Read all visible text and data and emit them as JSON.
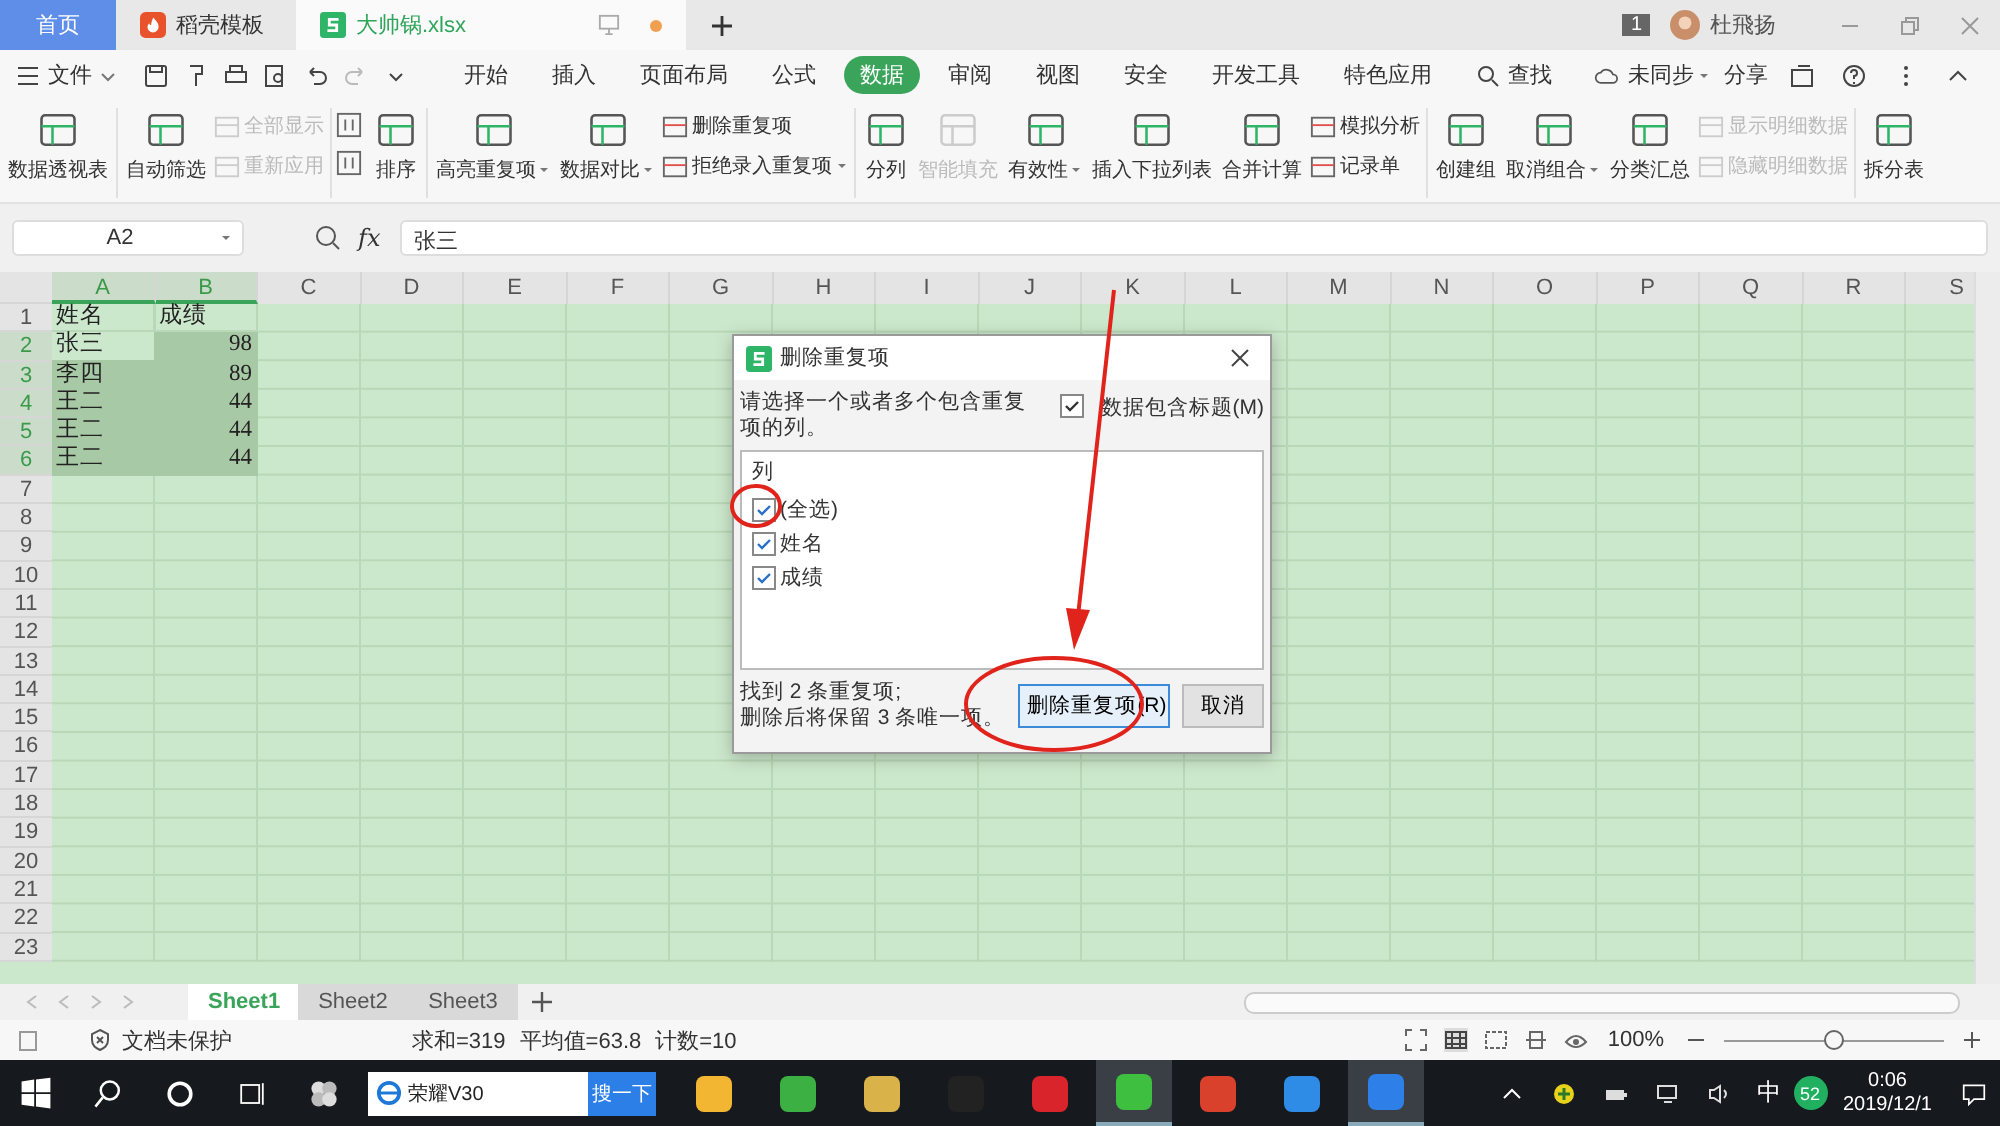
{
  "doc_tabs": [
    {
      "kind": "home",
      "label": "首页",
      "selected": false
    },
    {
      "kind": "template",
      "label": "稻壳模板",
      "selected": false
    },
    {
      "kind": "sheet",
      "label": "大帅锅.xlsx",
      "selected": true
    }
  ],
  "account": {
    "badge": "1",
    "name": "杜飛扬"
  },
  "menu": {
    "file": "文件",
    "tabs": [
      {
        "label": "开始",
        "selected": false
      },
      {
        "label": "插入",
        "selected": false
      },
      {
        "label": "页面布局",
        "selected": false
      },
      {
        "label": "公式",
        "selected": false
      },
      {
        "label": "数据",
        "selected": true
      },
      {
        "label": "审阅",
        "selected": false
      },
      {
        "label": "视图",
        "selected": false
      },
      {
        "label": "安全",
        "selected": false
      },
      {
        "label": "开发工具",
        "selected": false
      },
      {
        "label": "特色应用",
        "selected": false
      }
    ],
    "search": "查找",
    "sync": "未同步",
    "share": "分享"
  },
  "ribbon": [
    [
      {
        "kind": "large",
        "label": "数据透视表",
        "disabled": false,
        "dropdown": false
      }
    ],
    [
      {
        "kind": "large",
        "label": "自动筛选",
        "disabled": false,
        "dropdown": false
      },
      {
        "kind": "stack",
        "rows": [
          {
            "label": "全部显示",
            "disabled": true,
            "dropdown": false
          },
          {
            "label": "重新应用",
            "disabled": true,
            "dropdown": false
          }
        ]
      }
    ],
    [
      {
        "kind": "sort",
        "label": "排序",
        "disabled": false,
        "dropdown": false
      }
    ],
    [
      {
        "kind": "large",
        "label": "高亮重复项",
        "disabled": false,
        "dropdown": true
      },
      {
        "kind": "large",
        "label": "数据对比",
        "disabled": false,
        "dropdown": true
      },
      {
        "kind": "stack",
        "rows": [
          {
            "label": "删除重复项",
            "disabled": false,
            "dropdown": false
          },
          {
            "label": "拒绝录入重复项",
            "disabled": false,
            "dropdown": true
          }
        ]
      }
    ],
    [
      {
        "kind": "large",
        "label": "分列",
        "disabled": false,
        "dropdown": false
      },
      {
        "kind": "large",
        "label": "智能填充",
        "disabled": true,
        "dropdown": false
      },
      {
        "kind": "large",
        "label": "有效性",
        "disabled": false,
        "dropdown": true
      },
      {
        "kind": "large",
        "label": "插入下拉列表",
        "disabled": false,
        "dropdown": false
      },
      {
        "kind": "large",
        "label": "合并计算",
        "disabled": false,
        "dropdown": false
      },
      {
        "kind": "stack",
        "rows": [
          {
            "label": "模拟分析",
            "disabled": false,
            "dropdown": false
          },
          {
            "label": "记录单",
            "disabled": false,
            "dropdown": false
          }
        ]
      }
    ],
    [
      {
        "kind": "large",
        "label": "创建组",
        "disabled": false,
        "dropdown": false
      },
      {
        "kind": "large",
        "label": "取消组合",
        "disabled": false,
        "dropdown": true
      },
      {
        "kind": "large",
        "label": "分类汇总",
        "disabled": false,
        "dropdown": false
      },
      {
        "kind": "stack",
        "rows": [
          {
            "label": "显示明细数据",
            "disabled": true,
            "dropdown": false
          },
          {
            "label": "隐藏明细数据",
            "disabled": true,
            "dropdown": false
          }
        ]
      }
    ],
    [
      {
        "kind": "large",
        "label": "拆分表",
        "disabled": false,
        "dropdown": false
      }
    ]
  ],
  "formula_bar": {
    "cell": "A2",
    "fx": "fx",
    "value": "张三"
  },
  "columns": [
    {
      "label": "A",
      "selected": true
    },
    {
      "label": "B",
      "selected": true
    },
    {
      "label": "C",
      "selected": false
    },
    {
      "label": "D",
      "selected": false
    },
    {
      "label": "E",
      "selected": false
    },
    {
      "label": "F",
      "selected": false
    },
    {
      "label": "G",
      "selected": false
    },
    {
      "label": "H",
      "selected": false
    },
    {
      "label": "I",
      "selected": false
    },
    {
      "label": "J",
      "selected": false
    },
    {
      "label": "K",
      "selected": false
    },
    {
      "label": "L",
      "selected": false
    },
    {
      "label": "M",
      "selected": false
    },
    {
      "label": "N",
      "selected": false
    },
    {
      "label": "O",
      "selected": false
    },
    {
      "label": "P",
      "selected": false
    },
    {
      "label": "Q",
      "selected": false
    },
    {
      "label": "R",
      "selected": false
    },
    {
      "label": "S",
      "selected": false
    }
  ],
  "rows": [
    {
      "number": "1",
      "selected": false,
      "cells": [
        {
          "text": "姓名",
          "numeric": false,
          "active": false
        },
        {
          "text": "成绩",
          "numeric": false,
          "active": false
        }
      ]
    },
    {
      "number": "2",
      "selected": true,
      "cells": [
        {
          "text": "张三",
          "numeric": false,
          "active": true
        },
        {
          "text": "98",
          "numeric": true,
          "active": false
        }
      ]
    },
    {
      "number": "3",
      "selected": true,
      "cells": [
        {
          "text": "李四",
          "numeric": false,
          "active": false
        },
        {
          "text": "89",
          "numeric": true,
          "active": false
        }
      ]
    },
    {
      "number": "4",
      "selected": true,
      "cells": [
        {
          "text": "王二",
          "numeric": false,
          "active": false
        },
        {
          "text": "44",
          "numeric": true,
          "active": false
        }
      ]
    },
    {
      "number": "5",
      "selected": true,
      "cells": [
        {
          "text": "王二",
          "numeric": false,
          "active": false
        },
        {
          "text": "44",
          "numeric": true,
          "active": false
        }
      ]
    },
    {
      "number": "6",
      "selected": true,
      "cells": [
        {
          "text": "王二",
          "numeric": false,
          "active": false
        },
        {
          "text": "44",
          "numeric": true,
          "active": false
        }
      ]
    },
    {
      "number": "7",
      "selected": false
    },
    {
      "number": "8",
      "selected": false
    },
    {
      "number": "9",
      "selected": false
    },
    {
      "number": "10",
      "selected": false
    },
    {
      "number": "11",
      "selected": false
    },
    {
      "number": "12",
      "selected": false
    },
    {
      "number": "13",
      "selected": false
    },
    {
      "number": "14",
      "selected": false
    },
    {
      "number": "15",
      "selected": false
    },
    {
      "number": "16",
      "selected": false
    },
    {
      "number": "17",
      "selected": false
    },
    {
      "number": "18",
      "selected": false
    },
    {
      "number": "19",
      "selected": false
    },
    {
      "number": "20",
      "selected": false
    },
    {
      "number": "21",
      "selected": false
    },
    {
      "number": "22",
      "selected": false
    },
    {
      "number": "23",
      "selected": false
    }
  ],
  "dialog": {
    "title": "删除重复项",
    "prompt": "请选择一个或者多个包含重复项的列。",
    "header_option": {
      "label": "数据包含标题(M)",
      "checked": true
    },
    "list_header": "列",
    "columns": [
      {
        "label": "(全选)",
        "checked": true
      },
      {
        "label": "姓名",
        "checked": true
      },
      {
        "label": "成绩",
        "checked": true
      }
    ],
    "summary": [
      "找到 2 条重复项;",
      "删除后将保留 3 条唯一项。"
    ],
    "confirm": "删除重复项(R)",
    "cancel": "取消"
  },
  "sheets": [
    {
      "label": "Sheet1",
      "selected": true
    },
    {
      "label": "Sheet2",
      "selected": false
    },
    {
      "label": "Sheet3",
      "selected": false
    }
  ],
  "status": {
    "protection": "文档未保护",
    "stats": [
      "求和=319",
      "平均值=63.8",
      "计数=10"
    ],
    "zoom": "100%",
    "zoom_level": {
      "level": 0.5
    }
  },
  "taskbar": {
    "search": "荣耀V30",
    "search_button": "搜一下",
    "apps": [
      {
        "color": "#f2b632",
        "selected": false
      },
      {
        "color": "#3cb043",
        "selected": false
      },
      {
        "color": "#d9b24a",
        "selected": false
      },
      {
        "color": "#222222",
        "selected": false
      },
      {
        "color": "#d8242a",
        "selected": false
      },
      {
        "color": "#3fbf3f",
        "selected": true
      },
      {
        "color": "#d9412c",
        "selected": false
      },
      {
        "color": "#2e8be6",
        "selected": false
      },
      {
        "color": "#2f7fe8",
        "selected": true
      }
    ],
    "ime": "中",
    "badge": "52",
    "time": "0:06",
    "date": "2019/12/1"
  }
}
